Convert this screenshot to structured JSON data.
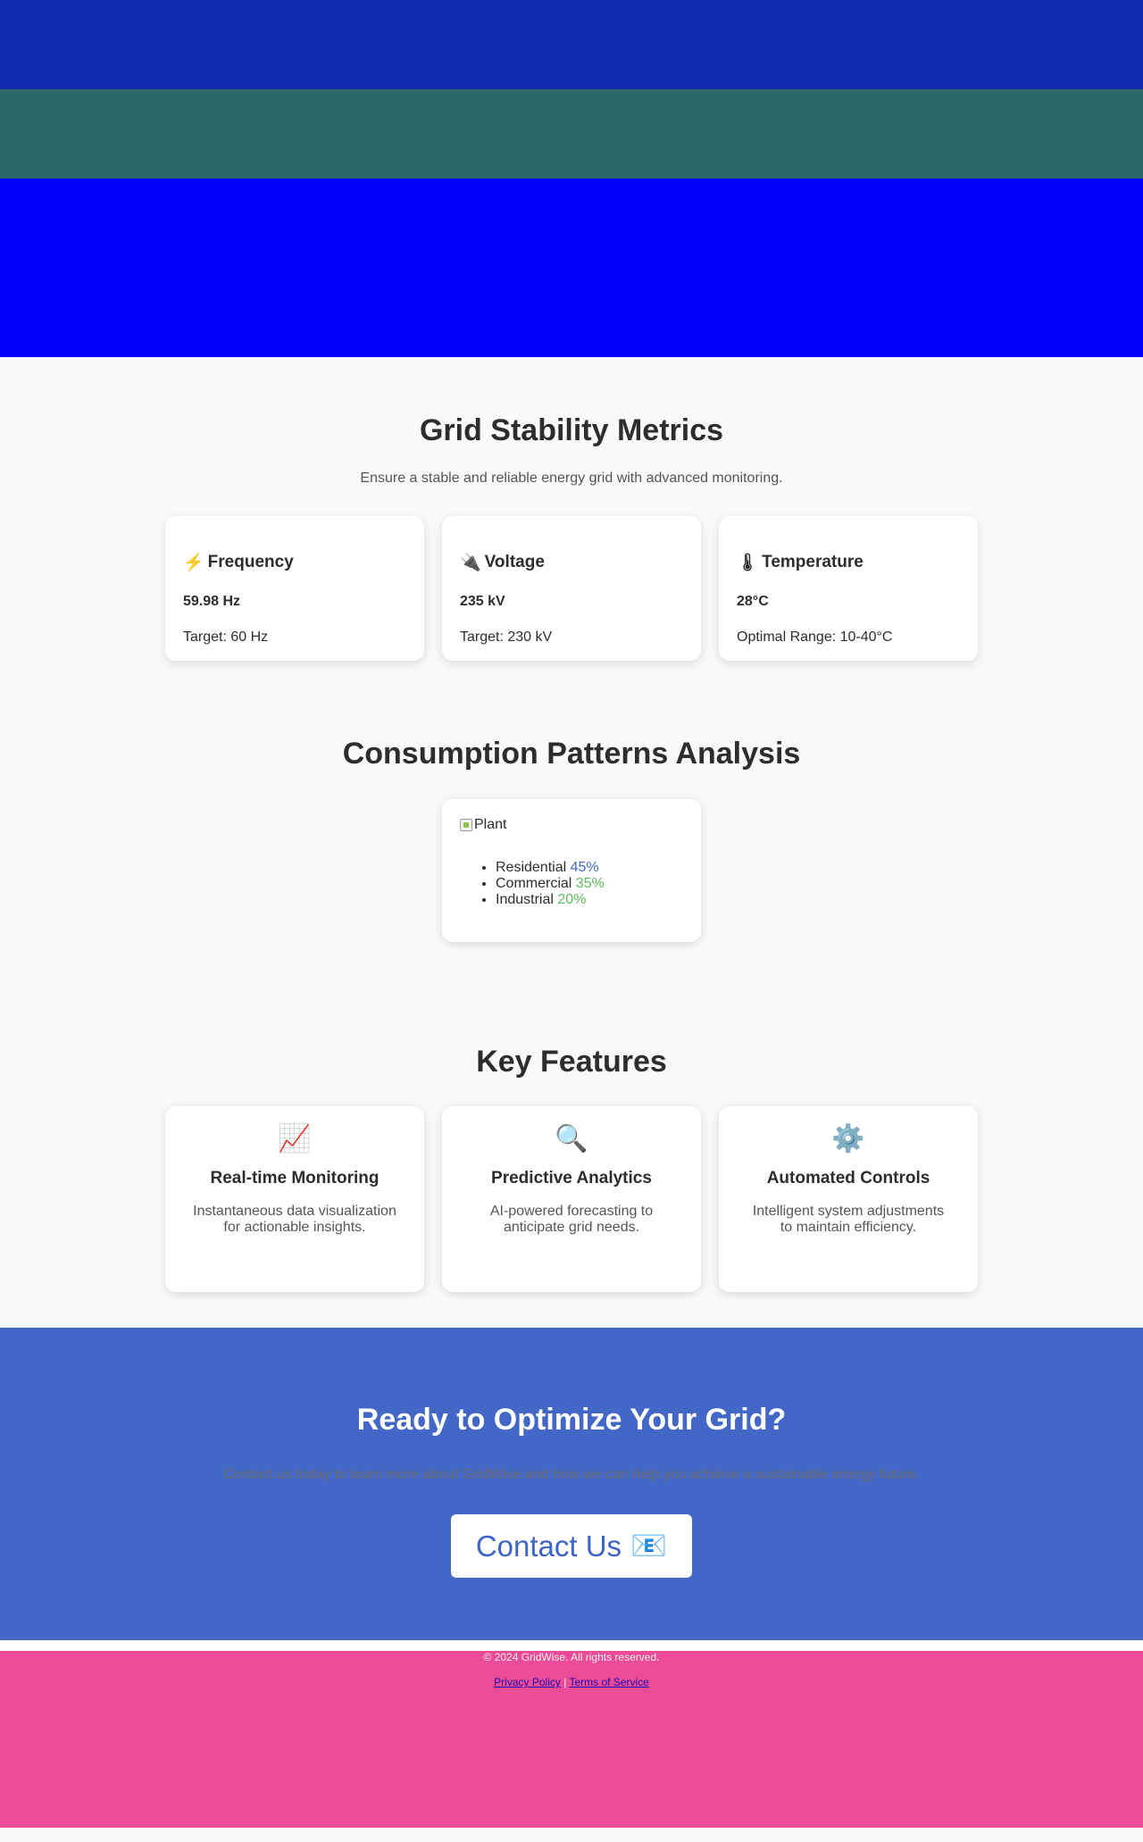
{
  "metrics": {
    "title": "Grid Stability Metrics",
    "subtitle": "Ensure a stable and reliable energy grid with advanced monitoring.",
    "cards": [
      {
        "icon": "⚡",
        "icon_name": "lightning-icon",
        "title": "Frequency",
        "value": "59.98 Hz",
        "target": "Target: 60 Hz"
      },
      {
        "icon": "🔌",
        "icon_name": "plug-icon",
        "title": "Voltage",
        "value": "235 kV",
        "target": "Target: 230 kV"
      },
      {
        "icon": "🌡",
        "icon_name": "thermometer-icon",
        "title": "Temperature",
        "value": "28°C",
        "target": "Optimal Range: 10-40°C"
      }
    ]
  },
  "consumption": {
    "title": "Consumption Patterns Analysis",
    "image_alt": "Plant",
    "items": [
      {
        "label": "Residential",
        "value": "45%",
        "color": "#4267c6"
      },
      {
        "label": "Commercial",
        "value": "35%",
        "color": "#5cb85c"
      },
      {
        "label": "Industrial",
        "value": "20%",
        "color": "#5cb85c"
      }
    ]
  },
  "features": {
    "title": "Key Features",
    "cards": [
      {
        "icon": "📈",
        "icon_name": "chart-up-icon",
        "title": "Real-time Monitoring",
        "desc": "Instantaneous data visualization for actionable insights."
      },
      {
        "icon": "🔍",
        "icon_name": "magnifier-icon",
        "title": "Predictive Analytics",
        "desc": "AI-powered forecasting to anticipate grid needs."
      },
      {
        "icon": "⚙️",
        "icon_name": "gear-icon",
        "title": "Automated Controls",
        "desc": "Intelligent system adjustments to maintain efficiency."
      }
    ]
  },
  "cta": {
    "title": "Ready to Optimize Your Grid?",
    "text": "Contact us today to learn more about GridWise and how we can help you achieve a sustainable energy future.",
    "button_label": "Contact Us",
    "button_icon": "📧"
  },
  "footer": {
    "copyright": "© 2024 GridWise. All rights reserved.",
    "privacy": "Privacy Policy",
    "separator": "|",
    "terms": "Terms of Service"
  },
  "colors": {
    "hero_band_1": "#112baf",
    "hero_band_2": "#2b6968",
    "hero_band_3": "#0000fa",
    "cta_background": "#4267c6",
    "footer_background": "#ec4b98"
  }
}
